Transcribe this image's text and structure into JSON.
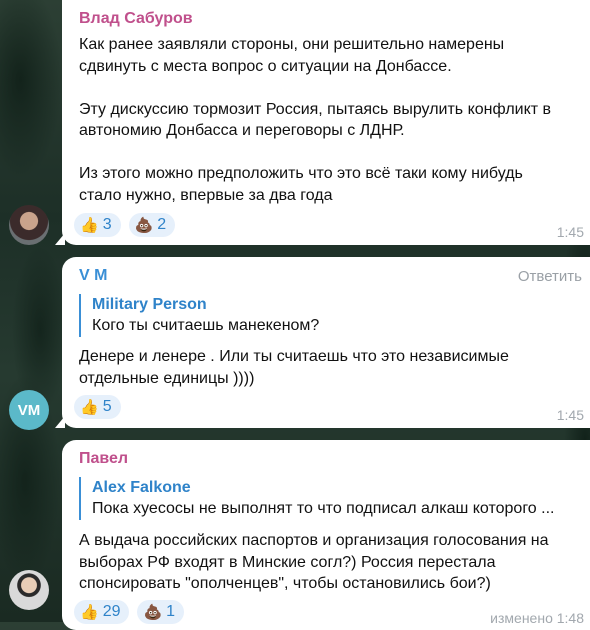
{
  "messages": [
    {
      "sender": "Влад Сабуров",
      "sender_color": "#c0508c",
      "text": "Как ранее заявляли стороны, они решительно намерены\nсдвинуть с места вопрос о ситуации на Донбассе.\n\nЭту дискуссию тормозит Россия, пытаясь вырулить конфликт в\nавтономию Донбасса и переговоры с ЛДНР.\n\nИз этого можно предположить что это всё таки кому нибудь\nстало нужно, впервые за два года",
      "reactions": [
        {
          "icon": "thumbs-up-icon",
          "emoji": "👍",
          "count": "3"
        },
        {
          "icon": "poop-icon",
          "emoji": "💩",
          "count": "2"
        }
      ],
      "time": "1:45"
    },
    {
      "sender": "V M",
      "sender_color": "#3a8fd6",
      "reply_label": "Ответить",
      "quote": {
        "author": "Military Person",
        "text": "Кого ты считаешь манекеном?"
      },
      "text": "Денере и ленере . Или ты считаешь что это независимые\nотдельные единицы ))))",
      "reactions": [
        {
          "icon": "thumbs-up-icon",
          "emoji": "👍",
          "count": "5"
        }
      ],
      "time": "1:45",
      "avatar_initials": "VM"
    },
    {
      "sender": "Павел",
      "sender_color": "#c0508c",
      "quote": {
        "author": "Alex Falkone",
        "text": "Пока хуесосы не выполнят то что подписал алкаш которого ..."
      },
      "text": "А выдача российских паспортов и организация голосования на\nвыборах РФ входят в Минские согл?) Россия перестала\nспонсировать \"ополченцев\", чтобы остановились бои?)",
      "reactions": [
        {
          "icon": "thumbs-up-icon",
          "emoji": "👍",
          "count": "29"
        },
        {
          "icon": "poop-icon",
          "emoji": "💩",
          "count": "1"
        }
      ],
      "time": "изменено 1:48"
    }
  ]
}
